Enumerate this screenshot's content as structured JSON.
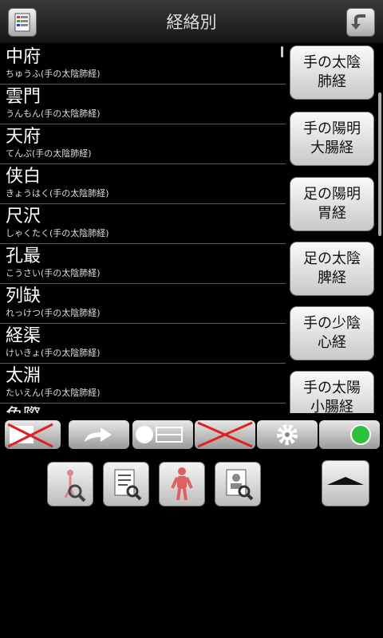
{
  "header": {
    "title": "経絡別",
    "menu_icon": "list-menu-icon",
    "back_icon": "undo-arrow-icon"
  },
  "points": [
    {
      "name": "中府",
      "reading": "ちゅうふ(手の太陰肺経)"
    },
    {
      "name": "雲門",
      "reading": "うんもん(手の太陰肺経)"
    },
    {
      "name": "天府",
      "reading": "てんぷ(手の太陰肺経)"
    },
    {
      "name": "侠白",
      "reading": "きょうはく(手の太陰肺経)"
    },
    {
      "name": "尺沢",
      "reading": "しゃくたく(手の太陰肺経)"
    },
    {
      "name": "孔最",
      "reading": "こうさい(手の太陰肺経)"
    },
    {
      "name": "列缺",
      "reading": "れっけつ(手の太陰肺経)"
    },
    {
      "name": "経渠",
      "reading": "けいきょ(手の太陰肺経)"
    },
    {
      "name": "太淵",
      "reading": "たいえん(手の太陰肺経)"
    },
    {
      "name": "魚際",
      "reading": ""
    }
  ],
  "meridians": [
    {
      "label": "手の太陰\n肺経"
    },
    {
      "label": "手の陽明\n大腸経"
    },
    {
      "label": "足の陽明\n胃経"
    },
    {
      "label": "足の太陰\n脾経"
    },
    {
      "label": "手の少陰\n心経"
    },
    {
      "label": "手の太陽\n小腸経"
    }
  ],
  "toolbar": {
    "items": [
      "disabled-display-icon",
      "redo-arrow-icon",
      "slider-toggle-icon",
      "disabled-icon",
      "gear-icon",
      "status-indicator-icon"
    ],
    "status_color": "#2fbf3a"
  },
  "bottom_buttons": [
    "person-search-icon",
    "document-search-icon",
    "body-point-icon",
    "profile-search-icon",
    "scroll-top-icon"
  ]
}
